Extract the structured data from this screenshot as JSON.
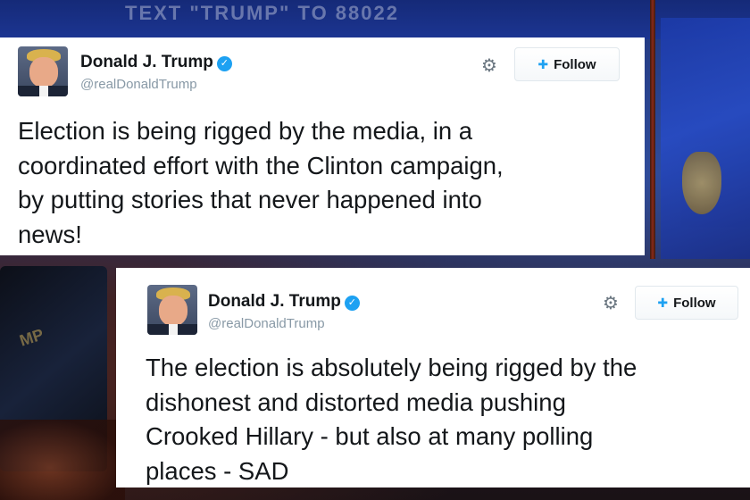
{
  "background": {
    "banner_text": "TEXT \"TRUMP\" TO 88022"
  },
  "tweets": [
    {
      "author_name": "Donald J. Trump",
      "verified_mark": "✓",
      "handle": "@realDonaldTrump",
      "follow_label": "Follow",
      "text_lines": [
        "Election is being rigged by the media, in a",
        "coordinated effort with the Clinton campaign,",
        "by putting stories that never happened into",
        "news!"
      ]
    },
    {
      "author_name": "Donald J. Trump",
      "verified_mark": "✓",
      "handle": "@realDonaldTrump",
      "follow_label": "Follow",
      "text_lines": [
        "The election is absolutely being rigged by the",
        "dishonest and distorted media pushing",
        "Crooked Hillary - but also at many polling",
        "places - SAD"
      ]
    }
  ],
  "icons": {
    "settings": "gear-icon",
    "follow": "add-user-icon",
    "verified": "verified-badge-icon"
  },
  "colors": {
    "accent": "#1da1f2",
    "text": "#14171a",
    "muted": "#8899a6"
  }
}
